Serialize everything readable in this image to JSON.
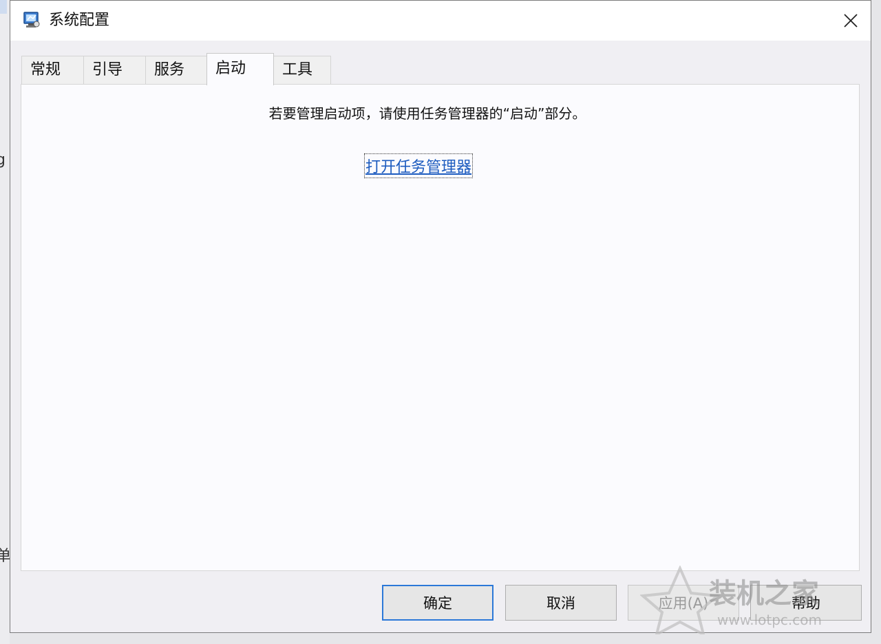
{
  "window": {
    "title": "系统配置"
  },
  "background_fragments": [
    "g",
    "单"
  ],
  "tabs": [
    {
      "label": "常规",
      "active": false
    },
    {
      "label": "引导",
      "active": false
    },
    {
      "label": "服务",
      "active": false
    },
    {
      "label": "启动",
      "active": true
    },
    {
      "label": "工具",
      "active": false
    }
  ],
  "startup_panel": {
    "message": "若要管理启动项，请使用任务管理器的“启动”部分。",
    "link_label": "打开任务管理器"
  },
  "buttons": {
    "ok": "确定",
    "cancel": "取消",
    "apply": "应用(A)",
    "help": "帮助"
  },
  "watermark": {
    "brand": "装机之家",
    "url": "www.lotpc.com"
  }
}
